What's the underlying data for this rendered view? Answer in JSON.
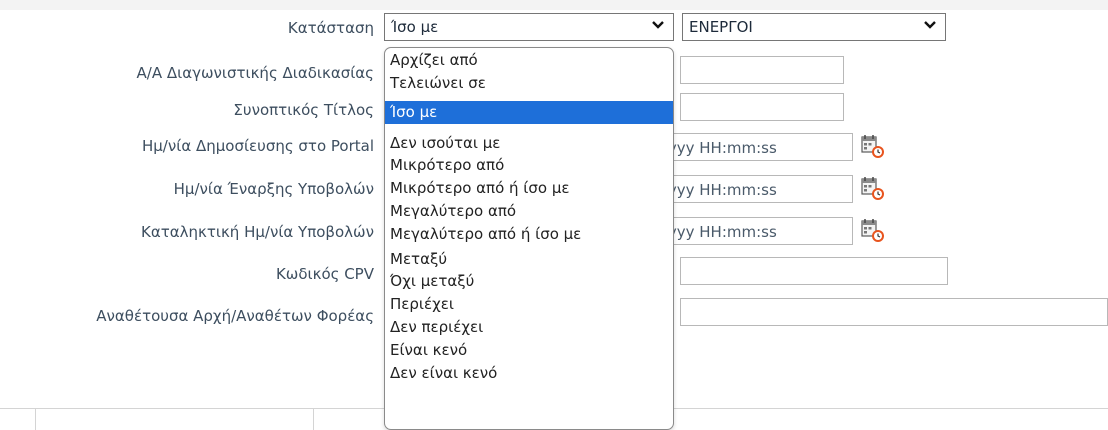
{
  "filters": {
    "rows": [
      {
        "label": "Κατάσταση"
      },
      {
        "label": "Α/Α Διαγωνιστικής Διαδικασίας"
      },
      {
        "label": "Συνοπτικός Τίτλος"
      },
      {
        "label": "Ημ/νία Δημοσίευσης στο Portal"
      },
      {
        "label": "Ημ/νία Έναρξης Υποβολών"
      },
      {
        "label": "Καταληκτική Ημ/νία Υποβολών"
      },
      {
        "label": "Κωδικός CPV"
      },
      {
        "label": "Αναθέτουσα Αρχή/Αναθέτων Φορέας"
      }
    ],
    "operator_select": {
      "value": "Ίσο με"
    },
    "status_select": {
      "value": "ΕΝΕΡΓΟΙ"
    },
    "date_placeholder": "yyyy HH:mm:ss"
  },
  "operator_dropdown": {
    "selected": "Ίσο με",
    "options": [
      "Αρχίζει από",
      "Τελειώνει σε",
      "Ίσο με",
      "Δεν ισούται με",
      "Μικρότερο από",
      "Μικρότερο από ή ίσο με",
      "Μεγαλύτερο από",
      "Μεγαλύτερο από ή ίσο με",
      "Μεταξύ",
      "Όχι μεταξύ",
      "Περιέχει",
      "Δεν περιέχει",
      "Είναι κενό",
      "Δεν είναι κενό"
    ]
  },
  "colors": {
    "label_text": "#3d4e5f",
    "selected_option_bg": "#1e6fd9",
    "input_border": "#b8b8b8"
  },
  "icons": {
    "calendar": "calendar-clock-icon",
    "chevron": "chevron-down-icon"
  }
}
